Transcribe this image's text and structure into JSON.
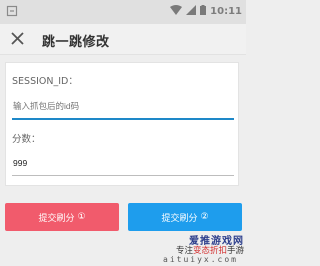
{
  "status_bar": {
    "time": "10:11"
  },
  "app_bar": {
    "title": "跳一跳修改",
    "close_icon": "close-icon"
  },
  "form": {
    "session_label": "SESSION_ID：",
    "session_placeholder": "输入抓包后的id码",
    "score_label": "分数：",
    "score_value": "999"
  },
  "buttons": {
    "submit_one_label": "提交刷分",
    "submit_one_badge": "①",
    "submit_two_label": "提交刷分",
    "submit_two_badge": "②"
  },
  "watermark": {
    "line1": "爱推游戏网",
    "line2_a": "专注",
    "line2_b": "变态折扣",
    "line2_c": "手游",
    "line3": "aituiyx.com"
  },
  "colors": {
    "primary": "#1e9ded",
    "danger": "#f15b6c",
    "underline_active": "#1e88c8"
  }
}
